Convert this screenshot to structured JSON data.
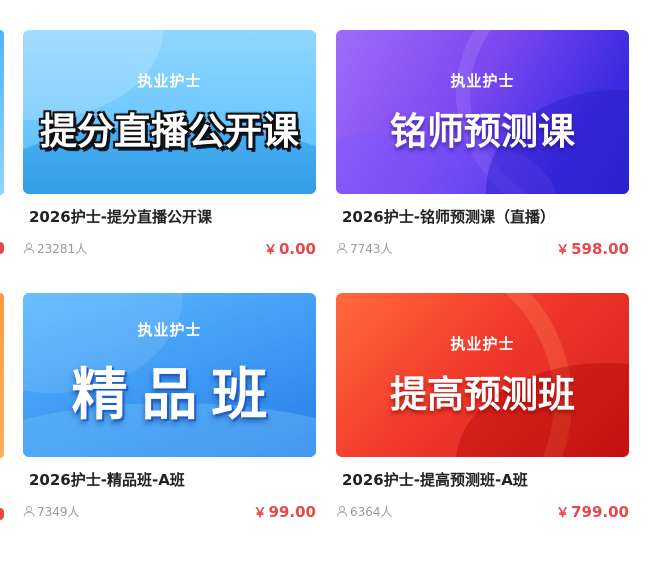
{
  "courses": [
    {
      "kicker": "执业护士",
      "headline": "提分直播公开课",
      "title": "2026护士-提分直播公开课",
      "students": "23281人",
      "currency": "￥",
      "price": "0.00"
    },
    {
      "kicker": "执业护士",
      "headline": "铭师预测课",
      "title": "2026护士-铭师预测课（直播）",
      "students": "7743人",
      "currency": "￥",
      "price": "598.00"
    },
    {
      "kicker": "执业护士",
      "headline": "精品班",
      "title": "2026护士-精品班-A班",
      "students": "7349人",
      "currency": "￥",
      "price": "99.00"
    },
    {
      "kicker": "执业护士",
      "headline": "提高预测班",
      "title": "2026护士-提高预测班-A班",
      "students": "6364人",
      "currency": "￥",
      "price": "799.00"
    }
  ],
  "colors": {
    "price": "#e8474b",
    "title": "#222222",
    "meta": "#999999"
  },
  "icons": {
    "students": "user-icon"
  }
}
